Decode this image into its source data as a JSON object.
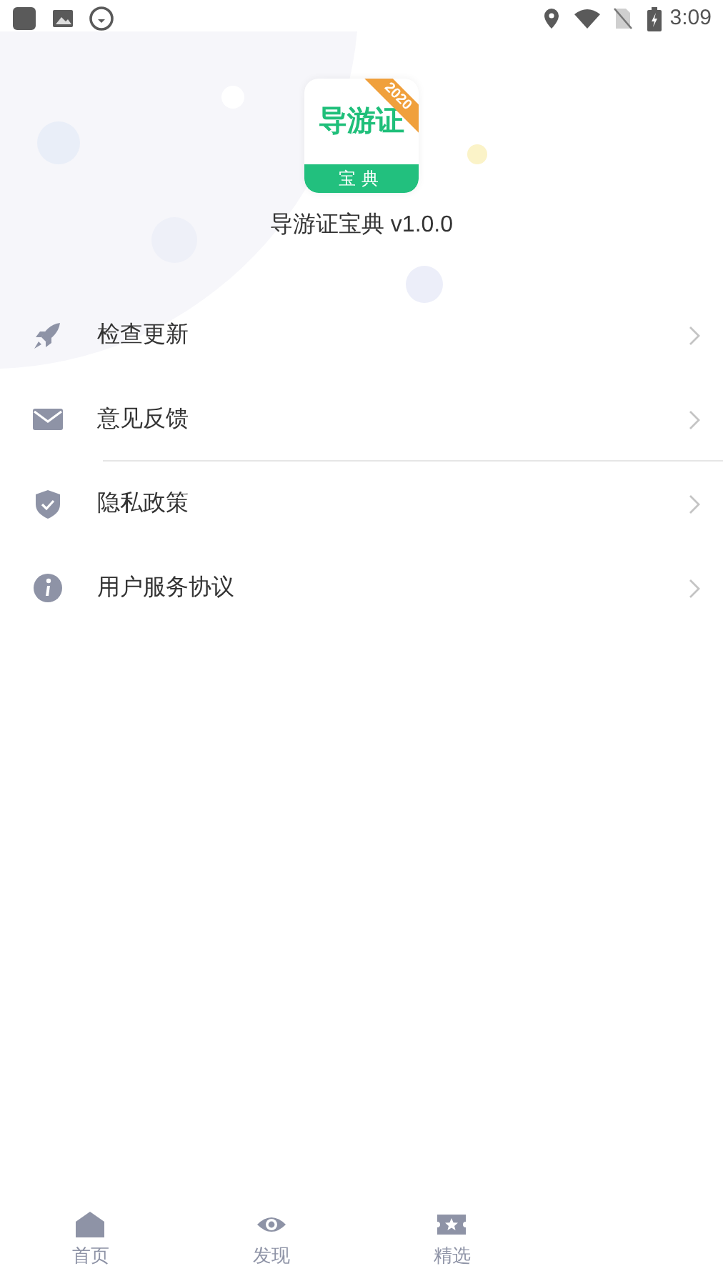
{
  "status_bar": {
    "time": "3:09"
  },
  "app": {
    "logo_title": "导游证",
    "logo_subtitle": "宝典",
    "logo_badge": "2020",
    "name": "导游证宝典 v1.0.0"
  },
  "menu": [
    {
      "kind": "rocket",
      "label": "检查更新",
      "divider": false
    },
    {
      "kind": "mail",
      "label": "意见反馈",
      "divider": true
    },
    {
      "kind": "shield",
      "label": "隐私政策",
      "divider": false
    },
    {
      "kind": "info",
      "label": "用户服务协议",
      "divider": false
    }
  ],
  "tabs": [
    {
      "kind": "home",
      "label": "首页"
    },
    {
      "kind": "eye",
      "label": "发现"
    },
    {
      "kind": "star",
      "label": "精选"
    }
  ]
}
